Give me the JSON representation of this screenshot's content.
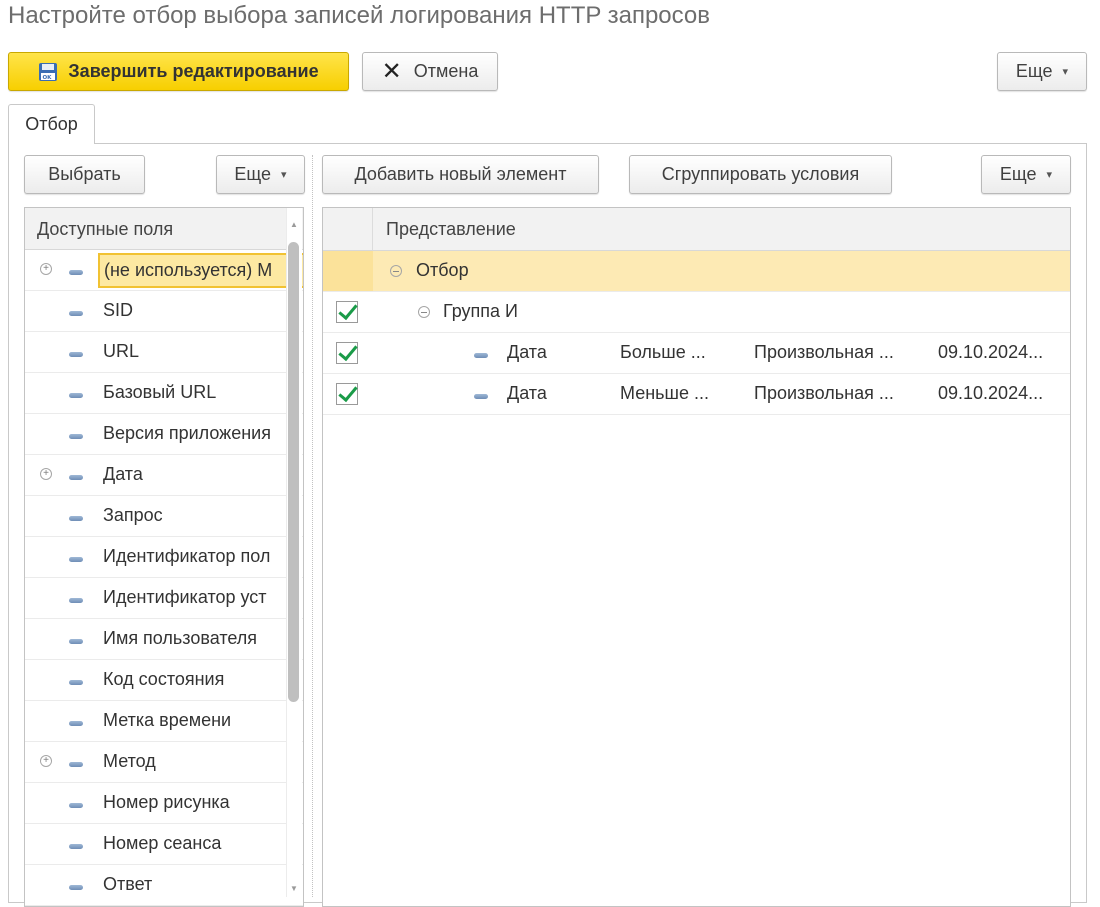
{
  "window": {
    "title": "Настройте отбор выбора записей логирования HTTP запросов"
  },
  "toolbar": {
    "finish_label": "Завершить редактирование",
    "cancel_label": "Отмена",
    "more_label": "Еще"
  },
  "tabs": [
    {
      "label": "Отбор"
    }
  ],
  "left_panel": {
    "select_label": "Выбрать",
    "more_label": "Еще",
    "header": "Доступные поля",
    "items": [
      {
        "label": "(не используется) М",
        "expandable": true,
        "selected": true
      },
      {
        "label": "SID"
      },
      {
        "label": "URL"
      },
      {
        "label": "Базовый URL"
      },
      {
        "label": "Версия приложения"
      },
      {
        "label": "Дата",
        "expandable": true
      },
      {
        "label": "Запрос"
      },
      {
        "label": "Идентификатор пол"
      },
      {
        "label": "Идентификатор уст"
      },
      {
        "label": "Имя пользователя"
      },
      {
        "label": "Код состояния"
      },
      {
        "label": "Метка времени"
      },
      {
        "label": "Метод",
        "expandable": true
      },
      {
        "label": "Номер рисунка"
      },
      {
        "label": "Номер сеанса"
      },
      {
        "label": "Ответ"
      }
    ]
  },
  "right_panel": {
    "add_label": "Добавить новый элемент",
    "group_label": "Сгруппировать условия",
    "more_label": "Еще",
    "header": "Представление",
    "root": {
      "label": "Отбор"
    },
    "group": {
      "label": "Группа И",
      "checked": true
    },
    "conditions": [
      {
        "field": "Дата",
        "comparison": "Больше ...",
        "type": "Произвольная ...",
        "value": "09.10.2024...",
        "checked": true
      },
      {
        "field": "Дата",
        "comparison": "Меньше ...",
        "type": "Произвольная ...",
        "value": "09.10.2024...",
        "checked": true
      }
    ]
  }
}
